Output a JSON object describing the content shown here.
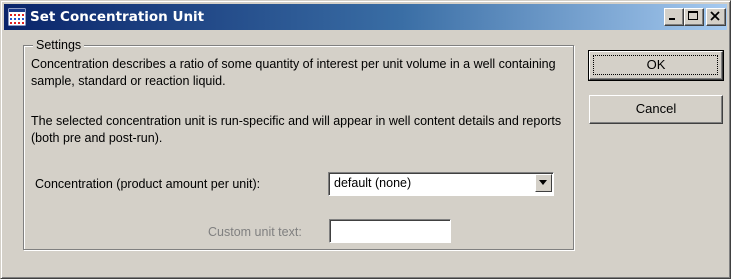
{
  "window": {
    "title": "Set Concentration Unit",
    "icon": "grid-app-icon",
    "controls": [
      "minimize-icon",
      "maximize-icon",
      "close-icon"
    ]
  },
  "settings": {
    "group_label": "Settings",
    "paragraph1": "Concentration describes a ratio of some quantity of interest per unit volume in a well containing sample, standard or reaction liquid.",
    "paragraph2": "The selected concentration unit is run-specific and will appear in well content details and reports (both pre and post-run).",
    "concentration_label": "Concentration (product amount per unit):",
    "concentration_value": "default (none)",
    "custom_unit_label": "Custom unit text:",
    "custom_unit_value": ""
  },
  "buttons": {
    "ok_label": "OK",
    "cancel_label": "Cancel"
  },
  "colors": {
    "titlebar_start": "#0a246a",
    "titlebar_end": "#a6caf0",
    "face": "#d4d0c8",
    "disabled_text": "#808080"
  }
}
